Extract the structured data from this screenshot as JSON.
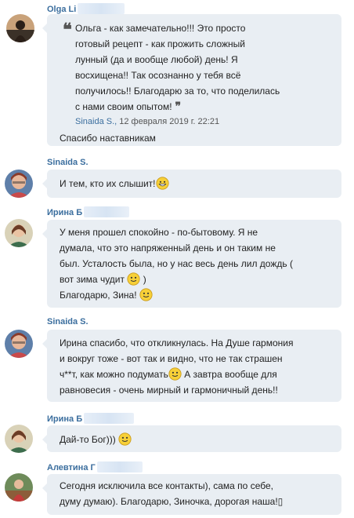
{
  "messages": [
    {
      "author": "Olga Li",
      "quote": {
        "lines": [
          "Ольга - как замечательно!!! Это просто",
          "готовый рецепт - как прожить сложный",
          "лунный (да и вообще любой) день! Я",
          "восхищена!! Так осознанно у тебя всё",
          "получилось!! Благодарю за то, что поделилась",
          "с нами своим опытом!"
        ],
        "open_mark": "❝",
        "close_mark": "❞",
        "attribution_author": "Sinaida S.,",
        "attribution_date": "12 февраля 2019 г. 22:21"
      },
      "lines": [
        "Спасибо наставникам"
      ]
    },
    {
      "author": "Sinaida S.",
      "lines": [
        "И тем, кто их слышит!"
      ]
    },
    {
      "author": "Ирина Б",
      "lines": [
        "У меня прошел спокойно - по-бытовому. Я не",
        "думала, что это напряженный день и он таким не",
        "был. Усталость была, но у нас весь день лил дождь (",
        "вот зима чудит",
        ")",
        " Благодарю, Зина!"
      ]
    },
    {
      "author": "Sinaida S.",
      "lines": [
        "Ирина спасибо, что откликнулась. На Душе гармония",
        "и вокруг тоже - вот так и видно, что не так страшен",
        "ч**т, как можно подумать",
        "А завтра вообще для",
        "равновесия - очень мирный и гармоничный день!!"
      ]
    },
    {
      "author": "Ирина Б",
      "lines": [
        "Дай-то Бог)))"
      ]
    },
    {
      "author": "Алевтина Г",
      "lines": [
        "Сегодня исключила все контакты), сама по себе,",
        "думу думаю). Благодарю, Зиночка, дорогая наша!",
        "▯"
      ]
    }
  ],
  "colors": {
    "author_name": "#3b6e9e",
    "bubble_bg": "#e9eef3",
    "text": "#222222"
  }
}
